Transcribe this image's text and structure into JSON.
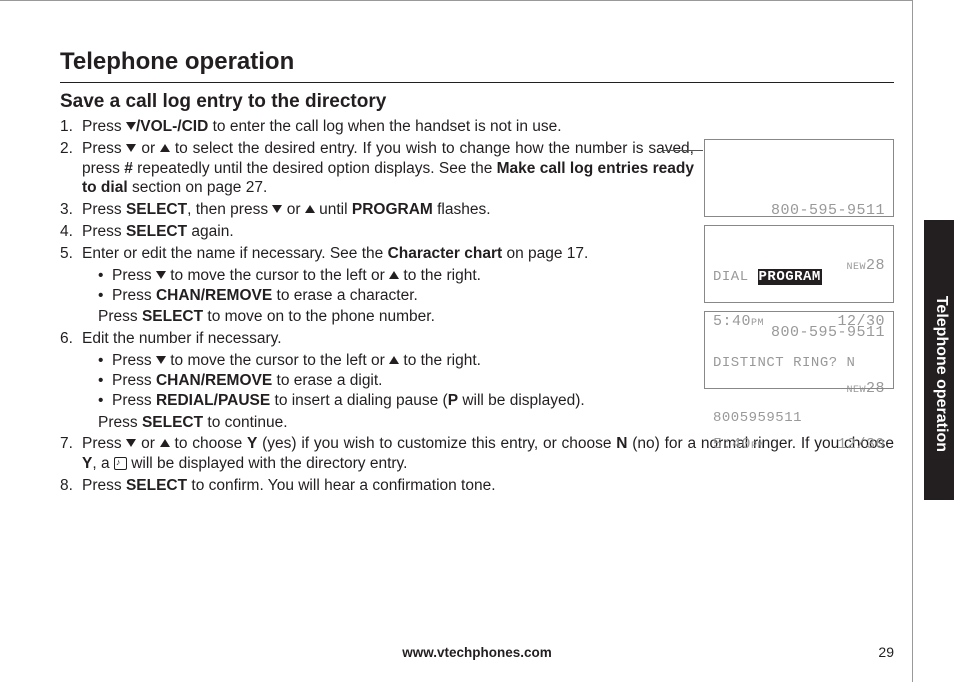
{
  "heading": "Telephone operation",
  "sub_heading": "Save a call log entry to the directory",
  "side_tab": "Telephone operation",
  "footer_url": "www.vtechphones.com",
  "page_number": "29",
  "steps": {
    "s1": {
      "pre": "Press ",
      "key": "/VOL-/CID",
      "post": " to enter the call log when the handset is not in use."
    },
    "s2": {
      "a": "Press ",
      "b": " or ",
      "c": " to select the desired entry. If you wish to change how the number is saved, press ",
      "hash": "#",
      "d": " repeatedly until the desired option displays. See the ",
      "ref": "Make call log entries ready to dial",
      "e": " section on page 27."
    },
    "s3": {
      "a": "Press ",
      "select": "SELECT",
      "b": ", then press ",
      "c": " or ",
      "d": " until ",
      "prog": "PROGRAM",
      "e": " flashes."
    },
    "s4": {
      "a": "Press ",
      "select": "SELECT",
      "b": " again."
    },
    "s5": {
      "a": "Enter or edit the name if necessary. See the ",
      "ref": "Character chart",
      "b": " on page 17.",
      "sub1": {
        "a": "Press ",
        "b": " to move the cursor to the left or ",
        "c": " to the right."
      },
      "sub2": {
        "a": "Press ",
        "key": "CHAN/REMOVE",
        "b": " to erase a character."
      },
      "note": {
        "a": "Press ",
        "key": "SELECT",
        "b": " to move on to the phone number."
      }
    },
    "s6": {
      "a": "Edit the number if necessary.",
      "sub1": {
        "a": "Press ",
        "b": " to move the cursor to the left or ",
        "c": " to the right."
      },
      "sub2": {
        "a": "Press ",
        "key": "CHAN/REMOVE",
        "b": " to erase a digit."
      },
      "sub3": {
        "a": "Press ",
        "key": "REDIAL/PAUSE",
        "b": " to insert a dialing pause (",
        "p": "P",
        "c": " will be displayed)."
      },
      "note": {
        "a": "Press ",
        "key": "SELECT",
        "b": " to continue."
      }
    },
    "s7": {
      "a": "Press ",
      "b": " or ",
      "c": " to choose ",
      "y": "Y",
      "d": " (yes) if you wish to customize this entry, or choose ",
      "n": "N",
      "e": " (no) for a normal ringer. If you choose ",
      "y2": "Y",
      "f": ", a ",
      "g": " will be displayed with the directory entry."
    },
    "s8": {
      "a": "Press ",
      "key": "SELECT",
      "b": " to confirm. You will hear a confirmation tone."
    }
  },
  "lcd": {
    "screen1": {
      "phone": "800-595-9511",
      "new": "NEW",
      "count": "28",
      "time": "5:40",
      "ampm": "PM",
      "date": "12/30"
    },
    "screen2": {
      "dial": "DIAL",
      "prog": "PROGRAM",
      "phone": "800-595-9511",
      "new": "NEW",
      "count": "28",
      "time": "5:40",
      "ampm": "PM",
      "date": "12/30"
    },
    "screen3": {
      "line1": "DISTINCT RING? N",
      "line2": "8005959511"
    }
  }
}
